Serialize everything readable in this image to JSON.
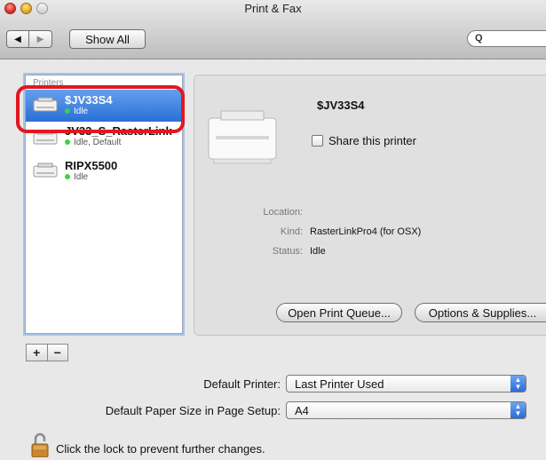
{
  "window": {
    "title": "Print & Fax"
  },
  "toolbar": {
    "back_glyph": "◀",
    "forward_glyph": "▶",
    "show_all_label": "Show All",
    "search_glyph": "Q"
  },
  "printers": {
    "heading": "Printers",
    "items": [
      {
        "name": "$JV33S4",
        "status": "Idle",
        "selected": true
      },
      {
        "name": "JV33_S_RasterLink",
        "status": "Idle, Default",
        "selected": false
      },
      {
        "name": "RIPX5500",
        "status": "Idle",
        "selected": false
      }
    ],
    "add_label": "+",
    "remove_label": "−"
  },
  "detail": {
    "printer_name": "$JV33S4",
    "share_label": "Share this printer",
    "share_checked": false,
    "location_label": "Location:",
    "location_value": "",
    "kind_label": "Kind:",
    "kind_value": "RasterLinkPro4 (for OSX)",
    "status_label": "Status:",
    "status_value": "Idle",
    "open_queue_label": "Open Print Queue...",
    "options_label": "Options & Supplies..."
  },
  "defaults": {
    "default_printer_label": "Default Printer:",
    "default_printer_value": "Last Printer Used",
    "paper_size_label": "Default Paper Size in Page Setup:",
    "paper_size_value": "A4"
  },
  "lock": {
    "text": "Click the lock to prevent further changes."
  },
  "colors": {
    "selection": "#2a6fd6",
    "highlight_ring": "#e01820",
    "status_dot": "#3fd23f"
  }
}
